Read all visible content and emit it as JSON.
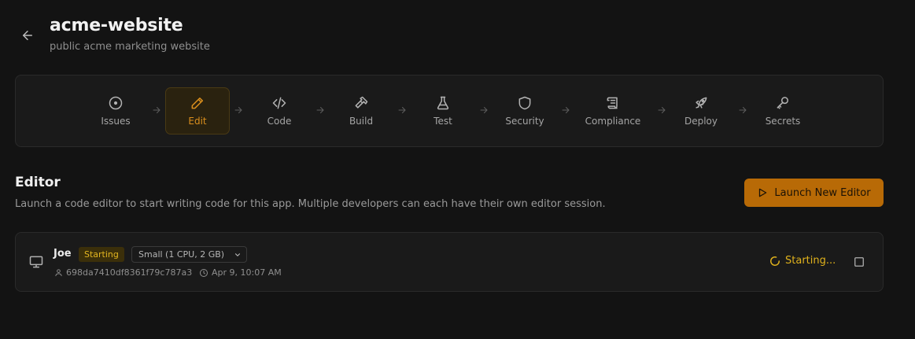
{
  "header": {
    "title": "acme-website",
    "subtitle": "public acme marketing website"
  },
  "pipeline": {
    "stages": [
      {
        "label": "Issues",
        "icon": "issues-circle-icon",
        "active": false
      },
      {
        "label": "Edit",
        "icon": "pencil-icon",
        "active": true
      },
      {
        "label": "Code",
        "icon": "code-icon",
        "active": false
      },
      {
        "label": "Build",
        "icon": "hammer-icon",
        "active": false
      },
      {
        "label": "Test",
        "icon": "flask-icon",
        "active": false
      },
      {
        "label": "Security",
        "icon": "shield-icon",
        "active": false
      },
      {
        "label": "Compliance",
        "icon": "scroll-icon",
        "active": false
      },
      {
        "label": "Deploy",
        "icon": "rocket-icon",
        "active": false
      },
      {
        "label": "Secrets",
        "icon": "key-icon",
        "active": false
      }
    ]
  },
  "editor": {
    "title": "Editor",
    "description": "Launch a code editor to start writing code for this app. Multiple developers can each have their own editor session.",
    "launch_label": "Launch New Editor"
  },
  "session": {
    "user": "Joe",
    "status_badge": "Starting",
    "size": "Small (1 CPU, 2 GB)",
    "id": "698da7410df8361f79c787a3",
    "timestamp": "Apr 9, 10:07 AM",
    "status_text": "Starting..."
  },
  "colors": {
    "background": "#131313",
    "card": "#1a1a1a",
    "accent": "#b86a06",
    "active_stage_text": "#d98e1d",
    "status_yellow": "#e0b21c"
  }
}
